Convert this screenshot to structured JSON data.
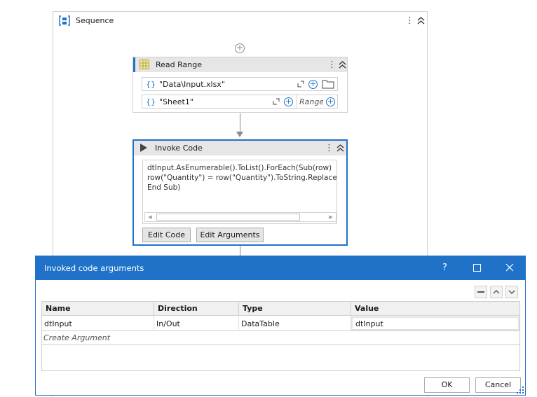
{
  "sequence": {
    "title": "Sequence",
    "kebab": "⋮"
  },
  "read_range": {
    "title": "Read Range",
    "kebab": "⋮",
    "workbook_path": "\"Data\\Input.xlsx\"",
    "sheet_name": "\"Sheet1\"",
    "range_placeholder": "Range",
    "brace": "{}"
  },
  "invoke_code": {
    "title": "Invoke Code",
    "kebab": "⋮",
    "code_lines": [
      "dtInput.AsEnumerable().ToList().ForEach(Sub(row)",
      "row(\"Quantity\") = row(\"Quantity\").ToString.Replace(\"Qty",
      "End Sub)"
    ],
    "edit_code_label": "Edit Code",
    "edit_arguments_label": "Edit Arguments"
  },
  "dialog": {
    "title": "Invoked code arguments",
    "help_label": "?",
    "columns": [
      "Name",
      "Direction",
      "Type",
      "Value"
    ],
    "rows": [
      {
        "name": "dtInput",
        "direction": "In/Out",
        "type": "DataTable",
        "value": "dtInput"
      }
    ],
    "create_argument_label": "Create Argument",
    "ok_label": "OK",
    "cancel_label": "Cancel"
  },
  "colors": {
    "accent": "#1f72c8",
    "header_gray": "#e6e6e6"
  }
}
